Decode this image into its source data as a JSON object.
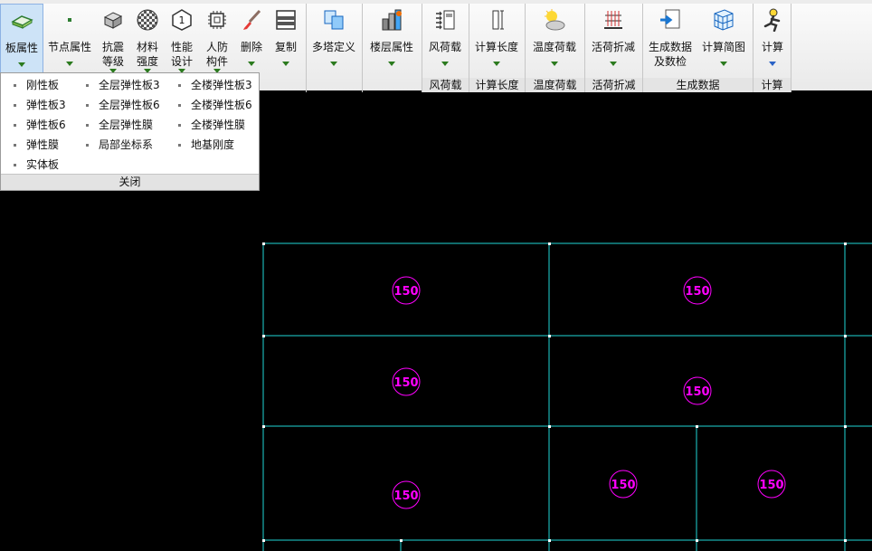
{
  "ribbon": {
    "buttons": [
      {
        "id": "slab-props",
        "label": "板属性",
        "icon": "slab-icon",
        "active": true
      },
      {
        "id": "node-props",
        "label": "节点属性",
        "icon": "node-icon"
      },
      {
        "id": "seismic",
        "label": "抗震\n等级",
        "icon": "seismic-grade-icon"
      },
      {
        "id": "material",
        "label": "材料\n强度",
        "icon": "material-strength-icon"
      },
      {
        "id": "performance",
        "label": "性能\n设计",
        "icon": "performance-design-icon"
      },
      {
        "id": "civil-defense",
        "label": "人防\n构件",
        "icon": "civil-defense-icon"
      },
      {
        "id": "delete",
        "label": "删除",
        "icon": "delete-icon"
      },
      {
        "id": "copy",
        "label": "复制",
        "icon": "copy-icon"
      },
      {
        "id": "multi-tower",
        "label": "多塔定义",
        "icon": "multi-tower-icon"
      },
      {
        "id": "floor-props",
        "label": "楼层属性",
        "icon": "floor-props-icon"
      },
      {
        "id": "wind-load",
        "label": "风荷载",
        "icon": "wind-load-icon"
      },
      {
        "id": "calc-length",
        "label": "计算长度",
        "icon": "calc-length-icon"
      },
      {
        "id": "temperature",
        "label": "温度荷载",
        "icon": "temperature-icon"
      },
      {
        "id": "live-reduce",
        "label": "活荷折减",
        "icon": "live-reduce-icon"
      },
      {
        "id": "gen-data",
        "label": "生成数据\n及数检",
        "icon": "generate-data-icon"
      },
      {
        "id": "calc-diagram",
        "label": "计算简图",
        "icon": "calc-diagram-icon"
      },
      {
        "id": "calculate",
        "label": "计算",
        "icon": "calculate-icon"
      }
    ],
    "group_labels": [
      "风荷载",
      "计算长度",
      "温度荷载",
      "活荷折减",
      "生成数据",
      "计算"
    ]
  },
  "dropdown": {
    "items": [
      "刚性板",
      "全层弹性板3",
      "全楼弹性板3",
      "弹性板3",
      "全层弹性板6",
      "全楼弹性板6",
      "弹性板6",
      "全层弹性膜",
      "全楼弹性膜",
      "弹性膜",
      "局部坐标系",
      "地基刚度",
      "实体板"
    ],
    "close_label": "关闭"
  },
  "canvas": {
    "slab_labels": [
      "150",
      "150",
      "150",
      "150",
      "150",
      "150",
      "150"
    ],
    "colors": {
      "grid": "#1fd6d6",
      "label": "#ff00ff",
      "node": "#ffffff",
      "background": "#000000"
    }
  }
}
